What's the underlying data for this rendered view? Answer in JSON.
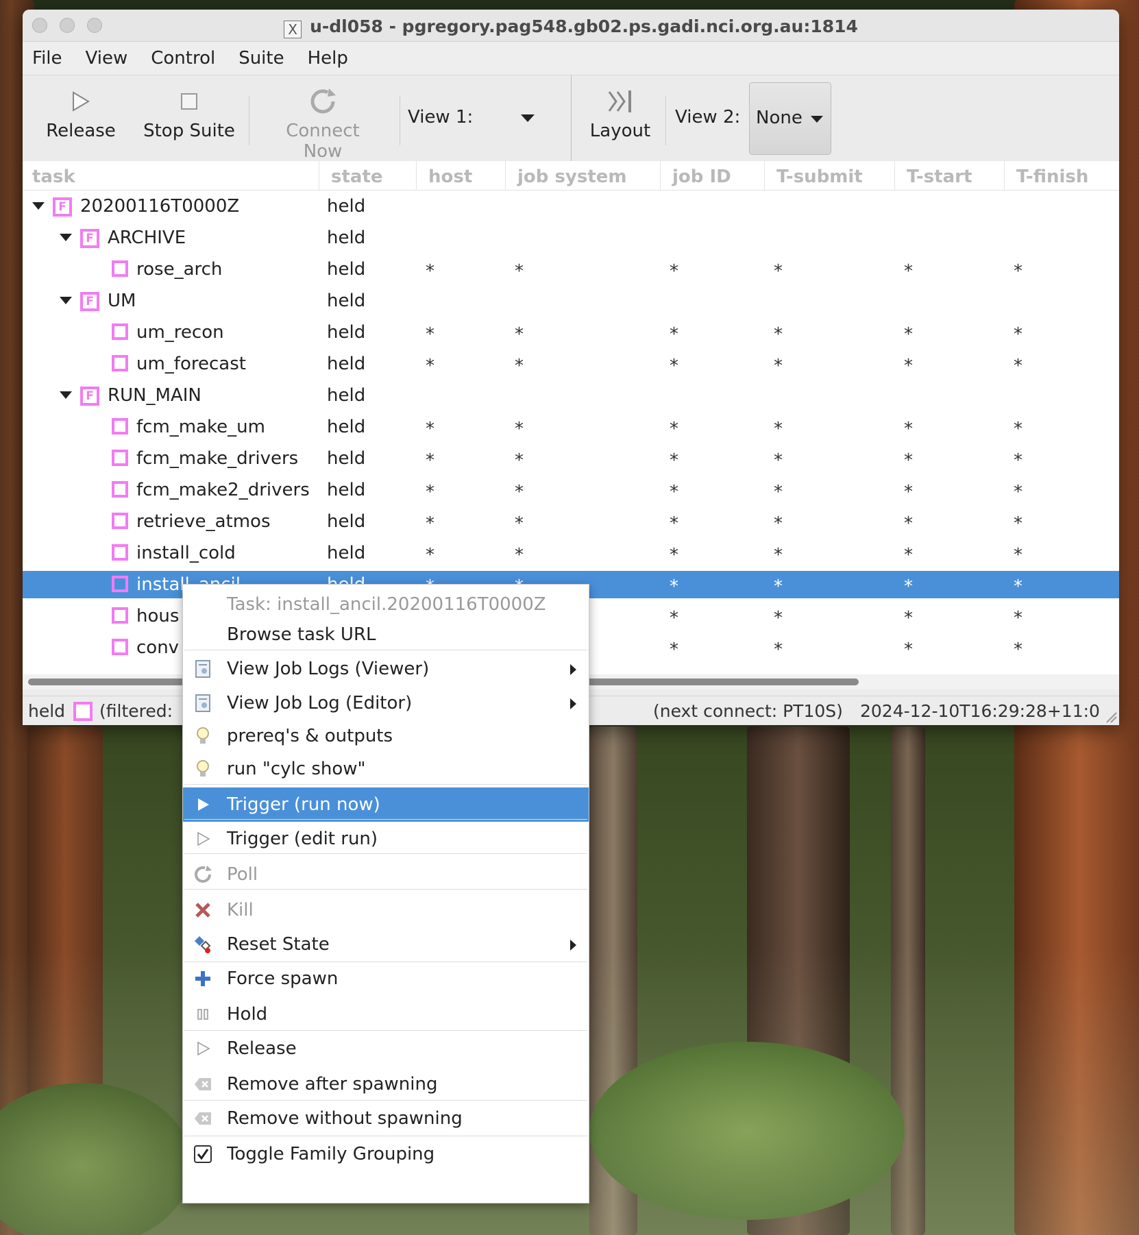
{
  "window": {
    "title": "u-dl058 - pgregory.pag548.gb02.ps.gadi.nci.org.au:1814"
  },
  "menubar": [
    "File",
    "View",
    "Control",
    "Suite",
    "Help"
  ],
  "toolbar": {
    "release": "Release",
    "stop_suite": "Stop Suite",
    "connect_now": "Connect Now",
    "view1_label": "View 1:",
    "layout": "Layout",
    "view2_label": "View 2:",
    "view2_value": "None"
  },
  "table": {
    "columns": [
      "task",
      "state",
      "host",
      "job system",
      "job ID",
      "T-submit",
      "T-start",
      "T-finish"
    ],
    "rows": [
      {
        "name": "20200116T0000Z",
        "state": "held",
        "level": 0,
        "family": true
      },
      {
        "name": "ARCHIVE",
        "state": "held",
        "level": 1,
        "family": true
      },
      {
        "name": "rose_arch",
        "state": "held",
        "level": 2,
        "family": false
      },
      {
        "name": "UM",
        "state": "held",
        "level": 1,
        "family": true
      },
      {
        "name": "um_recon",
        "state": "held",
        "level": 2,
        "family": false
      },
      {
        "name": "um_forecast",
        "state": "held",
        "level": 2,
        "family": false
      },
      {
        "name": "RUN_MAIN",
        "state": "held",
        "level": 1,
        "family": true
      },
      {
        "name": "fcm_make_um",
        "state": "held",
        "level": 2,
        "family": false
      },
      {
        "name": "fcm_make_drivers",
        "state": "held",
        "level": 2,
        "family": false
      },
      {
        "name": "fcm_make2_drivers",
        "state": "held",
        "level": 2,
        "family": false
      },
      {
        "name": "retrieve_atmos",
        "state": "held",
        "level": 2,
        "family": false
      },
      {
        "name": "install_cold",
        "state": "held",
        "level": 2,
        "family": false
      },
      {
        "name": "install_ancil",
        "state": "held",
        "level": 2,
        "family": false,
        "selected": true
      },
      {
        "name": "hous",
        "state": "",
        "level": 2,
        "family": false
      },
      {
        "name": "conv",
        "state": "",
        "level": 2,
        "family": false
      }
    ],
    "star": "*",
    "family_glyph": "F"
  },
  "statusbar": {
    "held": "held",
    "filtered": "(filtered:",
    "next_connect": "(next connect: PT10S)",
    "timestamp": "2024-12-10T16:29:28+11:0"
  },
  "context_menu": {
    "header": "Task: install_ancil.20200116T0000Z",
    "items": [
      {
        "label": "Browse task URL",
        "icon": "none"
      },
      {
        "label": "View Job Logs (Viewer)",
        "icon": "document-icon",
        "submenu": true
      },
      {
        "label": "View Job Log (Editor)",
        "icon": "document-icon",
        "submenu": true
      },
      {
        "label": "prereq's & outputs",
        "icon": "lightbulb-icon"
      },
      {
        "label": "run \"cylc show\"",
        "icon": "lightbulb-icon"
      },
      {
        "label": "Trigger (run now)",
        "icon": "play-icon",
        "highlighted": true
      },
      {
        "label": "Trigger (edit run)",
        "icon": "play-outline-icon"
      },
      {
        "label": "Poll",
        "icon": "refresh-icon",
        "disabled": true
      },
      {
        "label": "Kill",
        "icon": "kill-icon",
        "disabled": true
      },
      {
        "label": "Reset State",
        "icon": "reset-icon",
        "submenu": true
      },
      {
        "label": "Force spawn",
        "icon": "plus-icon"
      },
      {
        "label": "Hold",
        "icon": "pause-icon"
      },
      {
        "label": "Release",
        "icon": "play-outline-icon"
      },
      {
        "label": "Remove after spawning",
        "icon": "backspace-icon"
      },
      {
        "label": "Remove without spawning",
        "icon": "backspace-icon"
      },
      {
        "label": "Toggle Family Grouping",
        "icon": "checkbox-icon"
      }
    ]
  },
  "colors": {
    "accent": "#4a90d9",
    "held": "#f27cf2"
  }
}
